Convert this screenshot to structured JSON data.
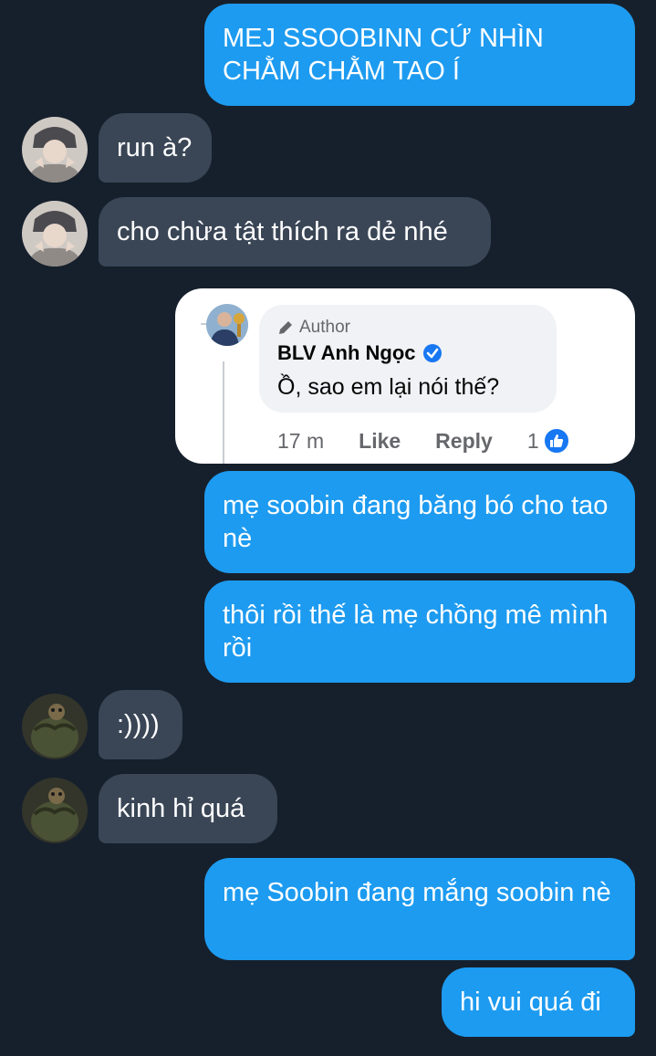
{
  "messages": [
    {
      "side": "sent",
      "text": "MEJ SSOOBINN CỨ NHÌN CHẰM CHẰM TAO Í"
    },
    {
      "side": "recv",
      "text": "run à?"
    },
    {
      "side": "recv",
      "text": "cho chừa tật thích ra dẻ nhé"
    },
    {
      "side": "sent",
      "text": "mẹ soobin đang băng bó cho tao nè"
    },
    {
      "side": "sent",
      "text": "thôi rồi thế là mẹ chồng mê mình rồi"
    },
    {
      "side": "recv",
      "text": ":))))"
    },
    {
      "side": "recv",
      "text": "kinh hỉ quá"
    },
    {
      "side": "sent",
      "text": "mẹ Soobin đang mắng soobin nè"
    },
    {
      "side": "sent",
      "text": "hi vui quá đi"
    }
  ],
  "embedded_comment": {
    "author_badge": "Author",
    "name": "BLV Anh Ngọc",
    "text": "Ồ, sao em lại nói thế?",
    "time": "17 m",
    "like_label": "Like",
    "reply_label": "Reply",
    "reaction_count": "1"
  },
  "colors": {
    "background": "#16202c",
    "sent_bubble": "#1d9bf0",
    "received_bubble": "#3a4656",
    "verified_badge": "#1877f2"
  }
}
